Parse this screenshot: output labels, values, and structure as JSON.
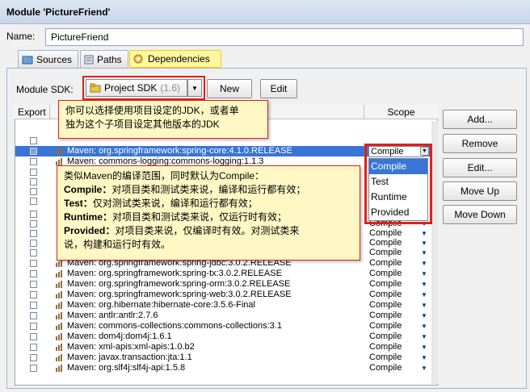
{
  "window": {
    "title": "Module 'PictureFriend'"
  },
  "name_field": {
    "label": "Name:",
    "value": "PictureFriend"
  },
  "tabs": [
    {
      "label": "Sources",
      "icon": "sources-folder-icon"
    },
    {
      "label": "Paths",
      "icon": "paths-icon"
    },
    {
      "label": "Dependencies",
      "icon": "dependencies-icon",
      "active": true
    }
  ],
  "sdk": {
    "label": "Module SDK:",
    "selected": "Project SDK",
    "version": "(1.6)",
    "new_label": "New",
    "edit_label": "Edit"
  },
  "table": {
    "columns": [
      "Export",
      "Scope"
    ],
    "rows": [
      {
        "text": "",
        "scope": ""
      },
      {
        "text": "Maven: org.springframework:spring-core:4.1.0.RELEASE",
        "scope": "Compile",
        "selected": true
      },
      {
        "text": "Maven: commons-logging:commons-logging:1.1.3",
        "scope": ""
      },
      {
        "text": "Maven: org.springframework:spring-jdbc:3.0.2.RELEASE",
        "scope": "Compile"
      },
      {
        "text": "Maven: org.springframework:spring-tx:3.0.2.RELEASE",
        "scope": "Compile"
      },
      {
        "text": "Maven: org.springframework:spring-orm:3.0.2.RELEASE",
        "scope": "Compile"
      },
      {
        "text": "Maven: org.springframework:spring-web:3.0.2.RELEASE",
        "scope": "Compile"
      },
      {
        "text": "Maven: org.hibernate:hibernate-core:3.5.6-Final",
        "scope": "Compile"
      },
      {
        "text": "Maven: antlr:antlr:2.7.6",
        "scope": "Compile"
      },
      {
        "text": "Maven: commons-collections:commons-collections:3.1",
        "scope": "Compile"
      },
      {
        "text": "Maven: dom4j:dom4j:1.6.1",
        "scope": "Compile"
      },
      {
        "text": "Maven: xml-apis:xml-apis:1.0.b2",
        "scope": "Compile"
      },
      {
        "text": "Maven: javax.transaction:jta:1.1",
        "scope": "Compile"
      },
      {
        "text": "Maven: org.slf4j:slf4j-api:1.5.8",
        "scope": "Compile"
      }
    ],
    "hidden_scopes": [
      "Compile",
      "Compile",
      "Compile",
      "Compile",
      "Compile",
      "Compile",
      "Compile"
    ]
  },
  "side_buttons": {
    "add": "Add...",
    "remove": "Remove",
    "edit": "Edit...",
    "move_up": "Move Up",
    "move_down": "Move Down"
  },
  "scope_dropdown": {
    "current": "Compile",
    "options": [
      "Compile",
      "Test",
      "Runtime",
      "Provided"
    ],
    "selected": "Compile"
  },
  "annotations": {
    "note1": {
      "line1": "你可以选择使用项目设定的JDK，或者单",
      "line2": "独为这个子项目设定其他版本的JDK"
    },
    "note2": {
      "intro": "类似Maven的编译范围，同时默认为Compile：",
      "compile_key": "Compile：",
      "compile_text": "对项目类和测试类来说，编译和运行都有效；",
      "test_key": "Test：",
      "test_text": "仅对测试类来说，编译和运行都有效；",
      "runtime_key": "Runtime：",
      "runtime_text": "对项目类和测试类来说，仅运行时有效；",
      "provided_key": "Provided：",
      "provided_text": "对项目类来说，仅编译时有效。对测试类来",
      "provided_text2": "说，构建和运行时有效。"
    }
  },
  "colors": {
    "accent": "#3875d7",
    "highlight": "#e0201b",
    "note_bg": "#fff8c4",
    "tab_highlight": "#fff7a0"
  }
}
